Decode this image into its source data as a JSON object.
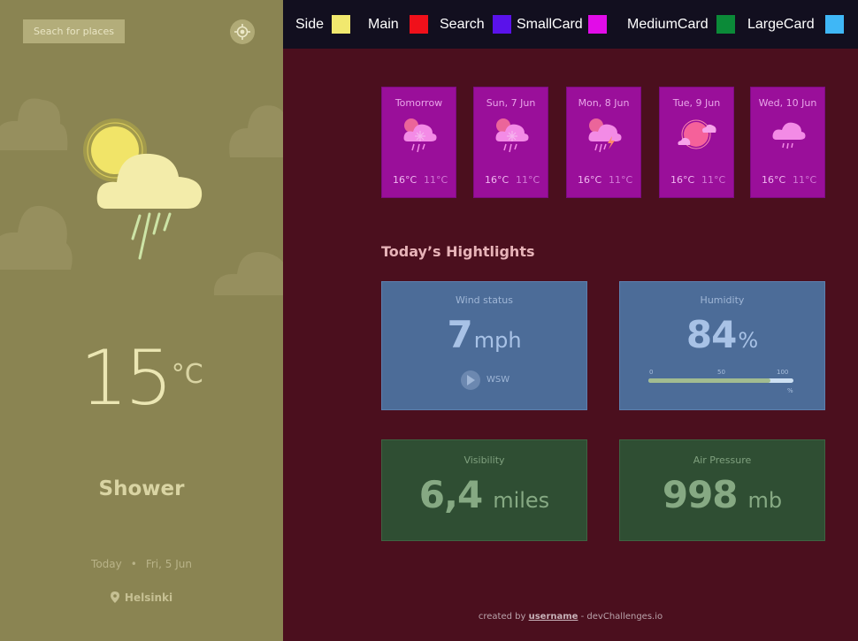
{
  "side": {
    "search_label": "Seach for places",
    "temperature": "15",
    "temperature_unit": "°C",
    "condition": "Shower",
    "date_label": "Today",
    "date_separator": "•",
    "date_value": "Fri, 5 Jun",
    "location": "Helsinki"
  },
  "legend": [
    {
      "label": "Side",
      "color": "#f1e86e"
    },
    {
      "label": "Main",
      "color": "#f0101a"
    },
    {
      "label": "Search",
      "color": "#5a12ea"
    },
    {
      "label": "SmallCard",
      "color": "#e20ce8"
    },
    {
      "label": "MediumCard",
      "color": "#0b8a38"
    },
    {
      "label": "LargeCard",
      "color": "#3fb7f6"
    }
  ],
  "forecast": [
    {
      "day": "Tomorrow",
      "max": "16°C",
      "min": "11°C",
      "icon": "sleet-icon"
    },
    {
      "day": "Sun, 7 Jun",
      "max": "16°C",
      "min": "11°C",
      "icon": "sleet-icon"
    },
    {
      "day": "Mon, 8 Jun",
      "max": "16°C",
      "min": "11°C",
      "icon": "thunderstorm-icon"
    },
    {
      "day": "Tue, 9 Jun",
      "max": "16°C",
      "min": "11°C",
      "icon": "partly-cloudy-icon"
    },
    {
      "day": "Wed, 10 Jun",
      "max": "16°C",
      "min": "11°C",
      "icon": "light-rain-icon"
    }
  ],
  "highlights": {
    "title": "Today’s Hightlights",
    "wind": {
      "title": "Wind status",
      "value": "7",
      "unit": "mph",
      "direction": "WSW"
    },
    "humidity": {
      "title": "Humidity",
      "value": "84",
      "unit": "%",
      "percent": 84,
      "tick_0": "0",
      "tick_50": "50",
      "tick_100": "100",
      "pct_label": "%"
    },
    "visibility": {
      "title": "Visibility",
      "value": "6,4",
      "unit": "miles"
    },
    "pressure": {
      "title": "Air Pressure",
      "value": "998",
      "unit": "mb"
    }
  },
  "footer": {
    "prefix": "created by ",
    "user": "username",
    "suffix": " - devChallenges.io"
  }
}
